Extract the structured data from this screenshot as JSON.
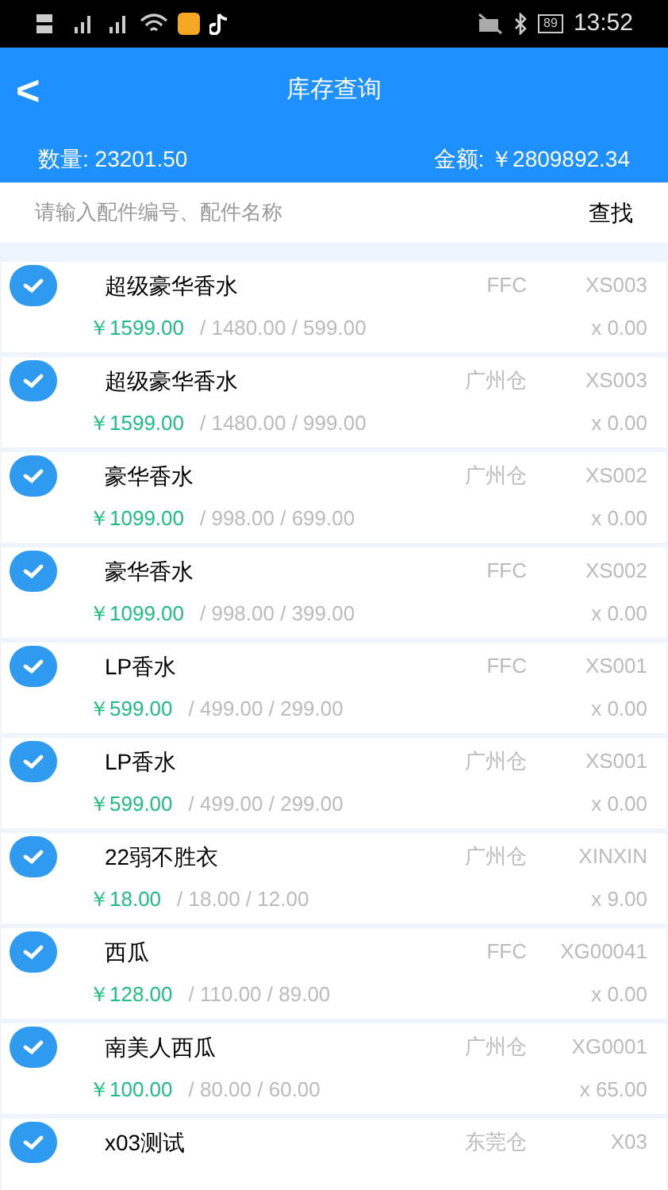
{
  "status_bar": {
    "battery": "89",
    "time": "13:52"
  },
  "header": {
    "back": "<",
    "title": "库存查询"
  },
  "summary": {
    "quantity": "数量: 23201.50",
    "amount": "金额: ￥2809892.34"
  },
  "search": {
    "placeholder": "请输入配件编号、配件名称",
    "button": "查找"
  },
  "items": [
    {
      "checked": true,
      "name": "超级豪华香水",
      "warehouse": "FFC",
      "code": "XS003",
      "price": "￥1599.00",
      "other_prices": "/ 1480.00 / 599.00",
      "qty": "x 0.00"
    },
    {
      "checked": true,
      "name": "超级豪华香水",
      "warehouse": "广州仓",
      "code": "XS003",
      "price": "￥1599.00",
      "other_prices": "/ 1480.00 / 999.00",
      "qty": "x 0.00"
    },
    {
      "checked": true,
      "name": "豪华香水",
      "warehouse": "广州仓",
      "code": "XS002",
      "price": "￥1099.00",
      "other_prices": "/ 998.00 / 699.00",
      "qty": "x 0.00"
    },
    {
      "checked": true,
      "name": "豪华香水",
      "warehouse": "FFC",
      "code": "XS002",
      "price": "￥1099.00",
      "other_prices": "/ 998.00 / 399.00",
      "qty": "x 0.00"
    },
    {
      "checked": true,
      "name": "LP香水",
      "warehouse": "FFC",
      "code": "XS001",
      "price": "￥599.00",
      "other_prices": "/ 499.00 / 299.00",
      "qty": "x 0.00"
    },
    {
      "checked": true,
      "name": "LP香水",
      "warehouse": "广州仓",
      "code": "XS001",
      "price": "￥599.00",
      "other_prices": "/ 499.00 / 299.00",
      "qty": "x 0.00"
    },
    {
      "checked": true,
      "name": "22弱不胜衣",
      "warehouse": "广州仓",
      "code": "XINXIN",
      "price": "￥18.00",
      "other_prices": "/ 18.00 / 12.00",
      "qty": "x 9.00"
    },
    {
      "checked": true,
      "name": "西瓜",
      "warehouse": "FFC",
      "code": "XG00041",
      "price": "￥128.00",
      "other_prices": "/ 110.00 / 89.00",
      "qty": "x 0.00"
    },
    {
      "checked": true,
      "name": "南美人西瓜",
      "warehouse": "广州仓",
      "code": "XG0001",
      "price": "￥100.00",
      "other_prices": "/ 80.00 / 60.00",
      "qty": "x 65.00"
    },
    {
      "checked": true,
      "name": "x03测试",
      "warehouse": "东莞仓",
      "code": "X03"
    }
  ]
}
